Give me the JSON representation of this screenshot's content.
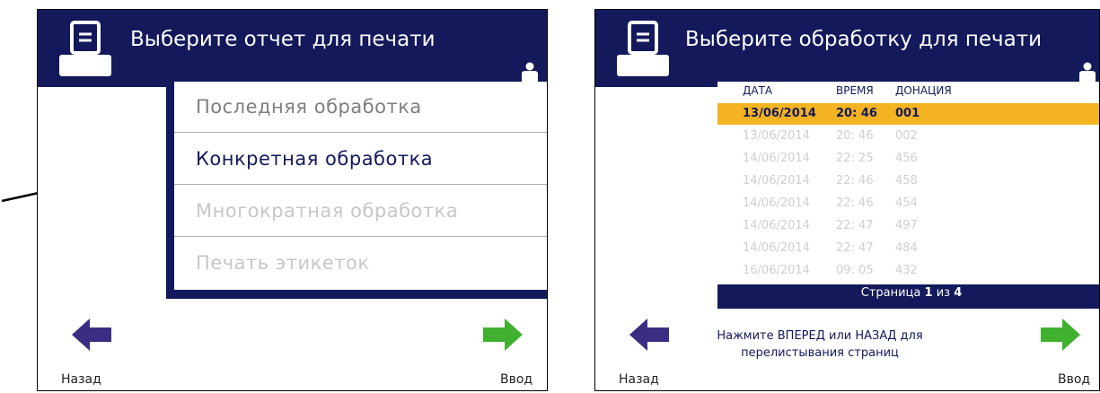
{
  "screen1": {
    "title": "Выберите отчет для печати",
    "menu": [
      {
        "label": "Последняя обработка",
        "state": "available"
      },
      {
        "label": "Конкретная обработка",
        "state": "highlighted"
      },
      {
        "label": "Многократная обработка",
        "state": "disabled"
      },
      {
        "label": "Печать этикеток",
        "state": "disabled"
      }
    ],
    "back_label": "Назад",
    "enter_label": "Ввод"
  },
  "screen2": {
    "title": "Выберите обработку для печати",
    "columns": [
      "ДАТА",
      "ВРЕМЯ",
      "ДОНАЦИЯ"
    ],
    "rows": [
      {
        "date": "13/06/2014",
        "time": "20: 46",
        "donation": "001",
        "selected": true
      },
      {
        "date": "13/06/2014",
        "time": "20: 46",
        "donation": "002",
        "selected": false
      },
      {
        "date": "14/06/2014",
        "time": "22: 25",
        "donation": "456",
        "selected": false
      },
      {
        "date": "14/06/2014",
        "time": "22: 46",
        "donation": "458",
        "selected": false
      },
      {
        "date": "14/06/2014",
        "time": "22: 46",
        "donation": "454",
        "selected": false
      },
      {
        "date": "14/06/2014",
        "time": "22: 47",
        "donation": "497",
        "selected": false
      },
      {
        "date": "14/06/2014",
        "time": "22: 47",
        "donation": "484",
        "selected": false
      },
      {
        "date": "16/06/2014",
        "time": "09: 05",
        "donation": "432",
        "selected": false
      }
    ],
    "page": {
      "prefix": "Страница",
      "current": "1",
      "sep": "из",
      "total": "4"
    },
    "hint_line1": "Нажмите ВПЕРЕД или НАЗАД для",
    "hint_line2": "перелистывания страниц",
    "back_label": "Назад",
    "enter_label": "Ввод"
  },
  "colors": {
    "header": "#13195a",
    "selected_row": "#f4b320",
    "back_arrow": "#3b2d82",
    "enter_arrow": "#3fb12f"
  },
  "icons": [
    "printer-icon",
    "user-icon",
    "back-arrow-icon",
    "enter-arrow-icon",
    "pointer-arrow"
  ]
}
